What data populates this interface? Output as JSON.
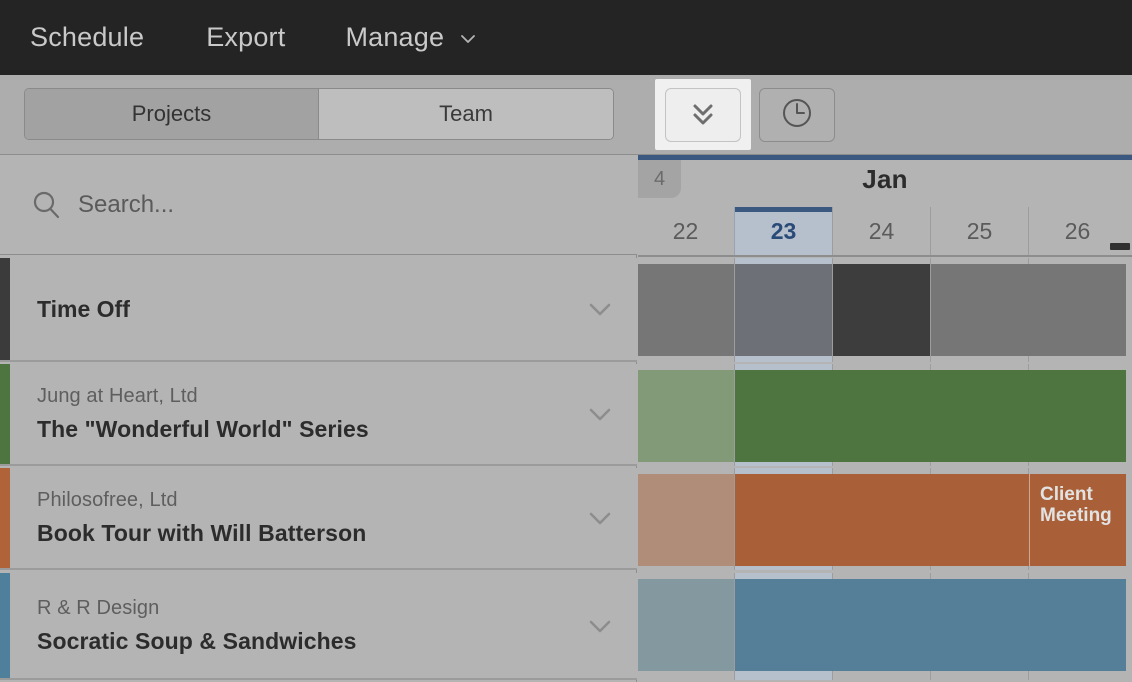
{
  "navbar": {
    "items": [
      {
        "label": "Schedule",
        "icon": null
      },
      {
        "label": "Export",
        "icon": null
      },
      {
        "label": "Manage",
        "icon": "chevron-down-icon"
      }
    ]
  },
  "toolbar": {
    "segmented": {
      "options": [
        "Projects",
        "Team"
      ],
      "selected": "Projects"
    },
    "buttons": [
      {
        "name": "collapse-all-button",
        "icon": "double-chevron-down-icon",
        "focused": true
      },
      {
        "name": "timeline-button",
        "icon": "clock-icon",
        "focused": false
      }
    ]
  },
  "search": {
    "icon": "search-icon",
    "placeholder": "Search...",
    "value": ""
  },
  "timeline_header": {
    "week_number": "4",
    "month": "Jan",
    "days": [
      "22",
      "23",
      "24",
      "25",
      "26"
    ],
    "today": "23",
    "accent_color": "#3b5880",
    "today_bg": "#b6bfcc"
  },
  "rows": [
    {
      "title": "Time Off",
      "client": "",
      "accent": "#3b3b3b",
      "chevron": "chevron-down-icon",
      "bars": [
        {
          "start_day": "22",
          "span": 1,
          "color": "#767676"
        },
        {
          "start_day": "23",
          "span": 1,
          "color": "#6d7177"
        },
        {
          "start_day": "24",
          "span": 1,
          "color": "#3d3d3d"
        },
        {
          "start_day": "25",
          "span": 2,
          "color": "#767676"
        }
      ],
      "chip": null
    },
    {
      "title": "The \"Wonderful World\" Series",
      "client": "Jung at Heart, Ltd",
      "accent": "#4e7440",
      "chevron": "chevron-down-icon",
      "bars": [
        {
          "start_day": "22",
          "span": 1,
          "color": "#839a79"
        },
        {
          "start_day": "23",
          "span": 4,
          "color": "#4e7440"
        }
      ],
      "chip": null
    },
    {
      "title": "Book Tour with Will Batterson",
      "client": "Philosofree, Ltd",
      "accent": "#b06239",
      "chevron": "chevron-down-icon",
      "bars": [
        {
          "start_day": "22",
          "span": 1,
          "color": "#b08d79"
        },
        {
          "start_day": "23",
          "span": 4,
          "color": "#a96039"
        }
      ],
      "chip": {
        "label": "Client Meeting",
        "start_day": "26",
        "span": 1,
        "color": "#a96039"
      }
    },
    {
      "title": "Socratic Soup & Sandwiches",
      "client": "R & R Design",
      "accent": "#4e7f9b",
      "chevron": "chevron-down-icon",
      "bars": [
        {
          "start_day": "22",
          "span": 1,
          "color": "#84989f"
        },
        {
          "start_day": "23",
          "span": 4,
          "color": "#557f98"
        }
      ],
      "chip": null
    }
  ]
}
